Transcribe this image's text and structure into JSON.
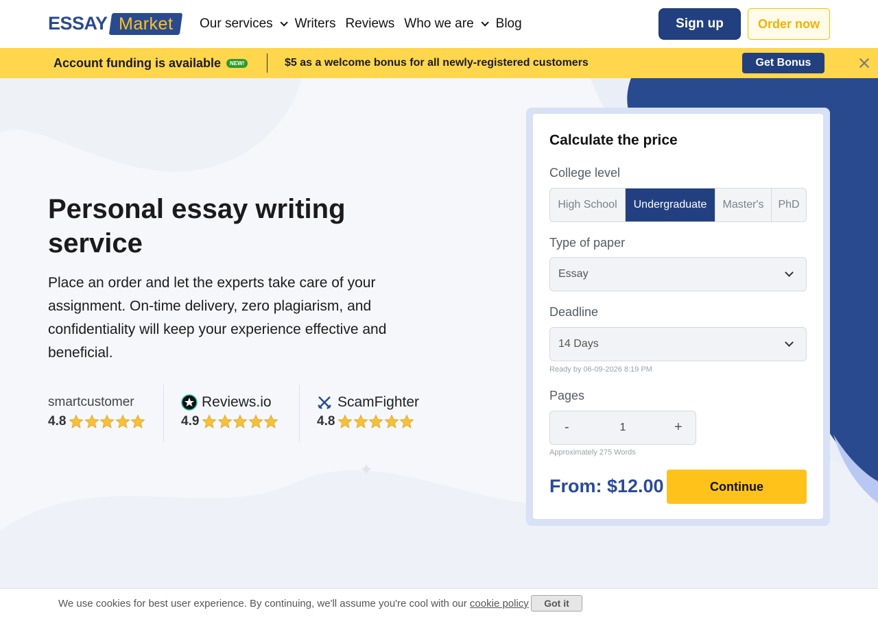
{
  "header": {
    "logo": {
      "left": "ESSAY",
      "right": "Market"
    },
    "nav": [
      {
        "label": "Our services",
        "has_dropdown": true
      },
      {
        "label": "Writers",
        "has_dropdown": false
      },
      {
        "label": "Reviews",
        "has_dropdown": false
      },
      {
        "label": "Who we are",
        "has_dropdown": true
      },
      {
        "label": "Blog",
        "has_dropdown": false
      }
    ],
    "signup_label": "Sign up",
    "order_label": "Order now"
  },
  "banner": {
    "left_text": "Account funding is available",
    "badge": "NEW!",
    "bonus_text": "$5 as a welcome bonus for all newly-registered customers",
    "button_label": "Get Bonus"
  },
  "hero": {
    "title": "Personal essay writing service",
    "description": "Place an order and let the experts take care of your assignment. On-time delivery, zero plagiarism, and confidentiality will keep your experience effective and beneficial."
  },
  "ratings": [
    {
      "name": "smartcustomer",
      "score": "4.8",
      "stars": 5
    },
    {
      "name": "Reviews.io",
      "score": "4.9",
      "stars": 5
    },
    {
      "name": "ScamFighter",
      "score": "4.8",
      "stars": 5
    }
  ],
  "calculator": {
    "title": "Calculate the price",
    "college_label": "College level",
    "levels": [
      "High School",
      "Undergraduate",
      "Master's",
      "PhD"
    ],
    "selected_level": "Undergraduate",
    "paper_label": "Type of paper",
    "paper_value": "Essay",
    "deadline_label": "Deadline",
    "deadline_value": "14 Days",
    "ready_by": "Ready by 06-09-2026 8:19 PM",
    "pages_label": "Pages",
    "pages_minus": "-",
    "pages_value": "1",
    "pages_plus": "+",
    "words_hint": "Approximately 275 Words",
    "price": "From: $12.00",
    "continue_label": "Continue"
  },
  "cookie": {
    "text": "We use cookies for best user experience. By continuing, we'll assume you're cool with our ",
    "link": "cookie policy",
    "button": "Got it"
  },
  "colors": {
    "brand_blue": "#22407f",
    "accent_yellow": "#ffc21b",
    "banner_yellow": "#ffd64c",
    "price_blue": "#2a4a9a"
  }
}
